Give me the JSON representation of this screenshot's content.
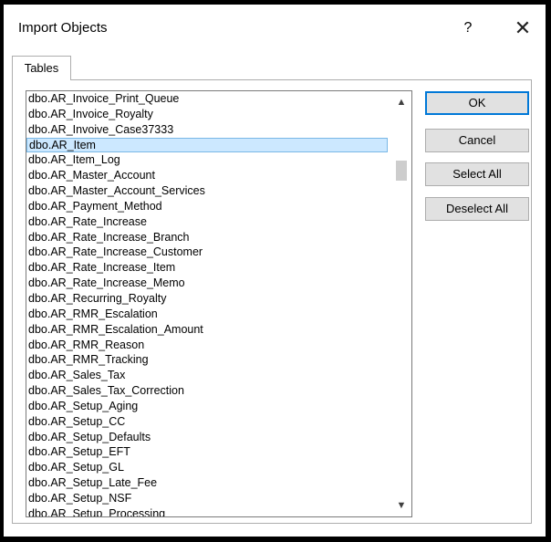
{
  "window": {
    "title": "Import Objects",
    "help_label": "?",
    "close_label": "✕"
  },
  "tabs": [
    {
      "label": "Tables"
    }
  ],
  "list": {
    "selected_index": 3,
    "items": [
      "dbo.AR_Invoice_Print_Queue",
      "dbo.AR_Invoice_Royalty",
      "dbo.AR_Invoive_Case37333",
      "dbo.AR_Item",
      "dbo.AR_Item_Log",
      "dbo.AR_Master_Account",
      "dbo.AR_Master_Account_Services",
      "dbo.AR_Payment_Method",
      "dbo.AR_Rate_Increase",
      "dbo.AR_Rate_Increase_Branch",
      "dbo.AR_Rate_Increase_Customer",
      "dbo.AR_Rate_Increase_Item",
      "dbo.AR_Rate_Increase_Memo",
      "dbo.AR_Recurring_Royalty",
      "dbo.AR_RMR_Escalation",
      "dbo.AR_RMR_Escalation_Amount",
      "dbo.AR_RMR_Reason",
      "dbo.AR_RMR_Tracking",
      "dbo.AR_Sales_Tax",
      "dbo.AR_Sales_Tax_Correction",
      "dbo.AR_Setup_Aging",
      "dbo.AR_Setup_CC",
      "dbo.AR_Setup_Defaults",
      "dbo.AR_Setup_EFT",
      "dbo.AR_Setup_GL",
      "dbo.AR_Setup_Late_Fee",
      "dbo.AR_Setup_NSF",
      "dbo.AR_Setup_Processing"
    ]
  },
  "scrollbar": {
    "up_icon": "chevron-up-icon",
    "down_icon": "chevron-down-icon",
    "up_glyph": "▲",
    "down_glyph": "▼"
  },
  "buttons": {
    "ok": "OK",
    "cancel": "Cancel",
    "select_all": "Select All",
    "deselect_all": "Deselect All"
  },
  "colors": {
    "selection_bg": "#cce8ff",
    "selection_border": "#7ab8e6",
    "default_button_border": "#0078d7",
    "button_bg": "#e1e1e1"
  }
}
